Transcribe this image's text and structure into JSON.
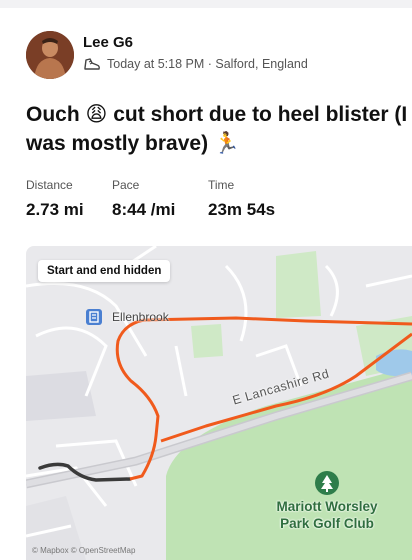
{
  "post": {
    "athlete_name": "Lee G6",
    "meta": "Today at 5:18 PM · Salford, England",
    "activity_icon": "shoe-icon",
    "title": "Ouch 😩 cut short due to heel blister (I was mostly brave) 🏃",
    "stats": [
      {
        "label": "Distance",
        "value": "2.73 mi"
      },
      {
        "label": "Pace",
        "value": "8:44 /mi"
      },
      {
        "label": "Time",
        "value": "23m 54s"
      }
    ]
  },
  "map": {
    "badge": "Start and end hidden",
    "place_label": "Ellenbrook",
    "road_label": "E Lancashire Rd",
    "golf_label": "Mariott Worsley Park Golf Club",
    "credit": "© Mapbox © OpenStreetMap",
    "route_color": "#f05a1c",
    "hidden_route_color": "#3a3a3a"
  }
}
